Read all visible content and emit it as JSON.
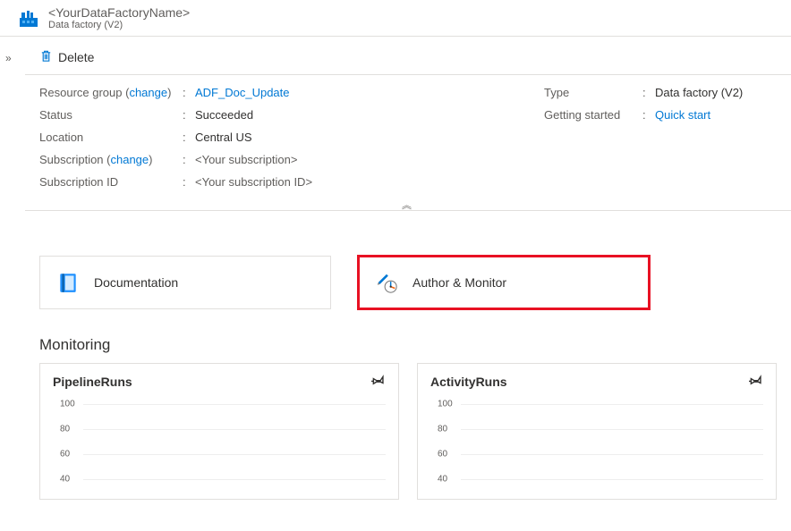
{
  "header": {
    "title": "<YourDataFactoryName>",
    "subtitle": "Data factory (V2)"
  },
  "toolbar": {
    "delete_label": "Delete"
  },
  "essentials": {
    "left": {
      "resource_group": {
        "label_prefix": "Resource group (",
        "change": "change",
        "label_suffix": ")",
        "value": "ADF_Doc_Update"
      },
      "status": {
        "label": "Status",
        "value": "Succeeded"
      },
      "location": {
        "label": "Location",
        "value": "Central US"
      },
      "subscription": {
        "label_prefix": "Subscription (",
        "change": "change",
        "label_suffix": ")",
        "value": "<Your subscription>"
      },
      "subscription_id": {
        "label": "Subscription ID",
        "value": "<Your subscription ID>"
      }
    },
    "right": {
      "type": {
        "label": "Type",
        "value": "Data factory (V2)"
      },
      "getting_started": {
        "label": "Getting started",
        "value": "Quick start"
      }
    }
  },
  "tiles": {
    "documentation": "Documentation",
    "author_monitor": "Author & Monitor"
  },
  "monitoring": {
    "title": "Monitoring",
    "charts": [
      {
        "title": "PipelineRuns"
      },
      {
        "title": "ActivityRuns"
      }
    ]
  },
  "chart_data": [
    {
      "type": "line",
      "title": "PipelineRuns",
      "y_ticks": [
        100,
        80,
        60,
        40
      ],
      "ylim": [
        40,
        100
      ],
      "series": []
    },
    {
      "type": "line",
      "title": "ActivityRuns",
      "y_ticks": [
        100,
        80,
        60,
        40
      ],
      "ylim": [
        40,
        100
      ],
      "series": []
    }
  ]
}
